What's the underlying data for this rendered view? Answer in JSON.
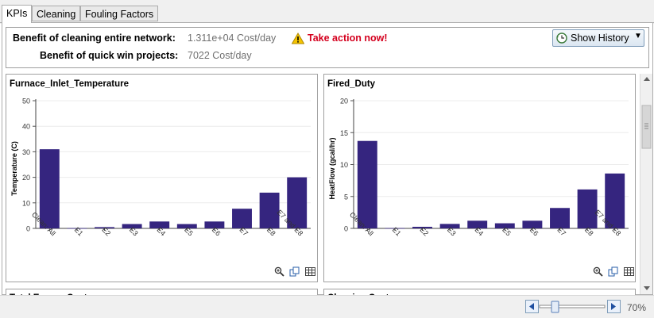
{
  "tabs": [
    {
      "label": "KPIs",
      "active": true
    },
    {
      "label": "Cleaning",
      "active": false
    },
    {
      "label": "Fouling Factors",
      "active": false
    }
  ],
  "kpi": {
    "network_label": "Benefit of cleaning entire network:",
    "network_value": "1.311e+04 Cost/day",
    "warning_text": "Take action now!",
    "quickwin_label": "Benefit of quick win projects:",
    "quickwin_value": "7022 Cost/day",
    "history_button": "Show History",
    "warning_color": "#d4001e"
  },
  "chart_data": [
    {
      "type": "bar",
      "title": "Furnace_Inlet_Temperature",
      "ylabel": "Temperature (C)",
      "xlabel": "",
      "categories": [
        "Clean: All",
        "E1",
        "E2",
        "E3",
        "E4",
        "E5",
        "E6",
        "E7",
        "E8",
        "E7 and E8"
      ],
      "values": [
        31,
        0.1,
        0.5,
        1.7,
        2.7,
        1.7,
        2.7,
        7.7,
        14,
        20
      ],
      "ylim": [
        0,
        50
      ],
      "yticks": [
        0,
        10,
        20,
        30,
        40,
        50
      ],
      "grid": true,
      "color": "#35257f"
    },
    {
      "type": "bar",
      "title": "Fired_Duty",
      "ylabel": "HeatFlow (gcal/hr)",
      "xlabel": "",
      "categories": [
        "Clean: All",
        "E1",
        "E2",
        "E3",
        "E4",
        "E5",
        "E6",
        "E7",
        "E8",
        "E7 and E8"
      ],
      "values": [
        13.7,
        0.05,
        0.25,
        0.7,
        1.2,
        0.8,
        1.2,
        3.2,
        6.1,
        8.6
      ],
      "ylim": [
        0,
        20
      ],
      "yticks": [
        0,
        5,
        10,
        15,
        20
      ],
      "grid": true,
      "color": "#35257f"
    }
  ],
  "lower_panels": [
    "Total Energy Cost",
    "Cleaning Cost"
  ],
  "zoom": {
    "level": "70%",
    "fraction": 0.3
  }
}
